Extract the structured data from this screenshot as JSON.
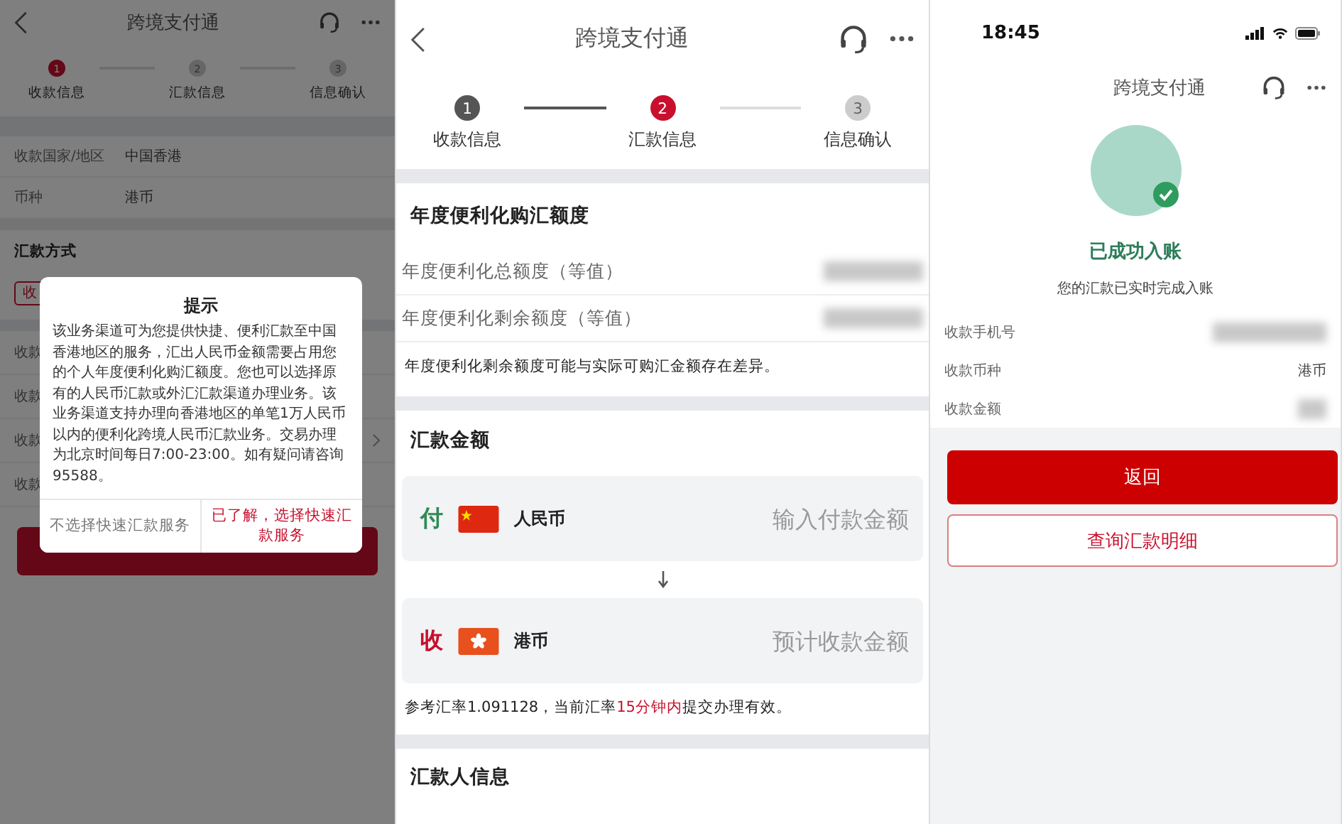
{
  "screen_1": {
    "header": {
      "title": "跨境支付通"
    },
    "steps": [
      {
        "number": "1",
        "label": "收款信息",
        "done": false,
        "current": true
      },
      {
        "number": "2",
        "label": "汇款信息",
        "done": false,
        "current": false
      },
      {
        "number": "3",
        "label": "信息确认",
        "done": false,
        "current": false
      }
    ],
    "fields": [
      {
        "label": "收款国家/地区",
        "value": "中国香港"
      },
      {
        "label": "币种",
        "value": "港币"
      }
    ],
    "section_title": "汇款方式",
    "tag": "收",
    "hidden_rows": [
      {
        "label": "收款",
        "chevron": false
      },
      {
        "label": "收款",
        "chevron": false
      },
      {
        "label": "收款",
        "chevron": true
      },
      {
        "label": "收款",
        "chevron": false
      }
    ],
    "dialog": {
      "title": "提示",
      "body": "该业务渠道可为您提供快捷、便利汇款至中国香港地区的服务，汇出人民币金额需要占用您的个人年度便利化购汇额度。您也可以选择原有的人民币汇款或外汇汇款渠道办理业务。该业务渠道支持办理向香港地区的单笔1万人民币以内的便利化跨境人民币汇款业务。交易办理为北京时间每日7:00-23:00。如有疑问请咨询95588。",
      "buttons": [
        {
          "label": "不选择快速汇款服务",
          "kind": "secondary"
        },
        {
          "label": "已了解，选择快速汇款服务",
          "kind": "primary"
        }
      ]
    }
  },
  "screen_2": {
    "header": {
      "title": "跨境支付通"
    },
    "steps": [
      {
        "number": "1",
        "label": "收款信息",
        "done": true,
        "current": false
      },
      {
        "number": "2",
        "label": "汇款信息",
        "done": false,
        "current": true
      },
      {
        "number": "3",
        "label": "信息确认",
        "done": false,
        "current": false
      }
    ],
    "quota": {
      "title": "年度便利化购汇额度",
      "rows": [
        {
          "label": "年度便利化总额度（等值）"
        },
        {
          "label": "年度便利化剩余额度（等值）"
        }
      ],
      "note": "年度便利化剩余额度可能与实际可购汇金额存在差异。"
    },
    "amount": {
      "title": "汇款金额",
      "cards": [
        {
          "mark": "付",
          "kind": "pay",
          "currency": "人民币",
          "placeholder": "输入付款金额"
        },
        {
          "mark": "收",
          "kind": "receive",
          "currency": "港币",
          "placeholder": "预计收款金额"
        }
      ],
      "rate_note": "参考汇率1.091128，当前汇率**15分钟内**提交办理有效。"
    },
    "remitter_title": "汇款人信息"
  },
  "screen_3": {
    "status_bar": {
      "time": "18:45"
    },
    "header": {
      "title": "跨境支付通"
    },
    "result": {
      "title": "已成功入账",
      "subtitle": "您的汇款已实时完成入账"
    },
    "rows": [
      {
        "label": "收款手机号",
        "redacted": true
      },
      {
        "label": "收款币种",
        "value": "港币",
        "redacted": false
      },
      {
        "label": "收款金额",
        "redacted": true
      }
    ],
    "buttons": [
      {
        "label": "返回",
        "kind": "primary"
      },
      {
        "label": "查询汇款明细",
        "kind": "outline"
      }
    ]
  }
}
